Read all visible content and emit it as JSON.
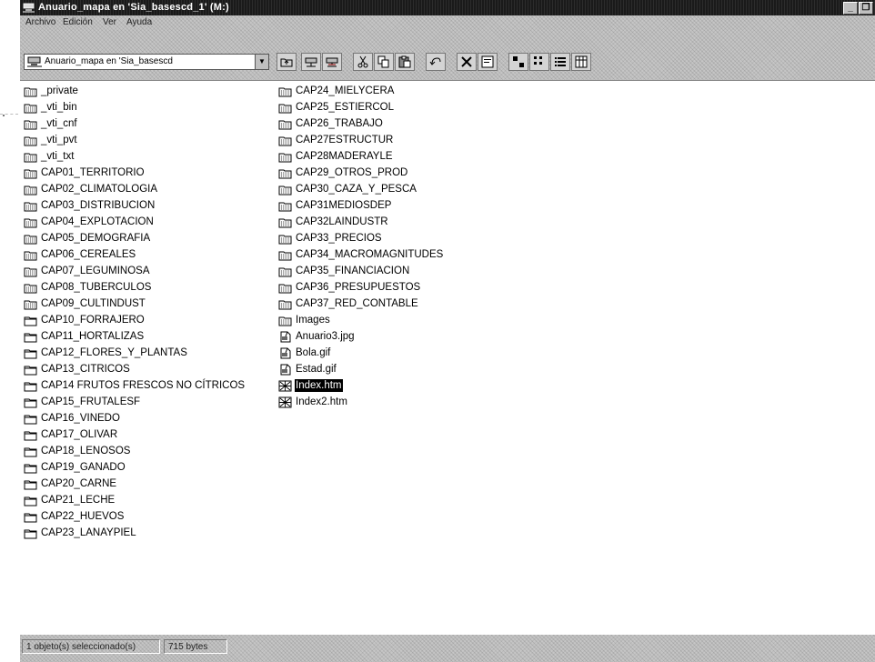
{
  "window": {
    "title": "Anuario_mapa en 'Sia_basescd_1' (M:)",
    "buttons": [
      "_",
      "❐"
    ]
  },
  "menu": [
    "Archivo",
    "Edición",
    "Ver",
    "Ayuda"
  ],
  "toolbar": {
    "address_text": "Anuario_mapa en 'Sia_basescd",
    "buttons": [
      "up-folder",
      "map-drive",
      "disconnect-drive",
      "cut",
      "copy",
      "paste",
      "undo",
      "delete",
      "properties",
      "large-icons",
      "small-icons",
      "list",
      "details"
    ]
  },
  "files": {
    "column1": [
      {
        "name": "_private",
        "type": "folder-special"
      },
      {
        "name": "_vti_bin",
        "type": "folder-special"
      },
      {
        "name": "_vti_cnf",
        "type": "folder-special"
      },
      {
        "name": "_vti_pvt",
        "type": "folder-special"
      },
      {
        "name": "_vti_txt",
        "type": "folder-special"
      },
      {
        "name": "CAP01_TERRITORIO",
        "type": "folder-special"
      },
      {
        "name": "CAP02_CLIMATOLOGIA",
        "type": "folder-special"
      },
      {
        "name": "CAP03_DISTRIBUCION",
        "type": "folder-special"
      },
      {
        "name": "CAP04_EXPLOTACION",
        "type": "folder-special"
      },
      {
        "name": "CAP05_DEMOGRAFIA",
        "type": "folder-special"
      },
      {
        "name": "CAP06_CEREALES",
        "type": "folder-special"
      },
      {
        "name": "CAP07_LEGUMINOSA",
        "type": "folder-special"
      },
      {
        "name": "CAP08_TUBERCULOS",
        "type": "folder-special"
      },
      {
        "name": "CAP09_CULTINDUST",
        "type": "folder-special"
      },
      {
        "name": "CAP10_FORRAJERO",
        "type": "folder"
      },
      {
        "name": "CAP11_HORTALIZAS",
        "type": "folder"
      },
      {
        "name": "CAP12_FLORES_Y_PLANTAS",
        "type": "folder"
      },
      {
        "name": "CAP13_CITRICOS",
        "type": "folder"
      },
      {
        "name": "CAP14 FRUTOS FRESCOS NO CÍTRICOS",
        "type": "folder"
      },
      {
        "name": "CAP15_FRUTALESF",
        "type": "folder"
      },
      {
        "name": "CAP16_VINEDO",
        "type": "folder"
      },
      {
        "name": "CAP17_OLIVAR",
        "type": "folder"
      },
      {
        "name": "CAP18_LENOSOS",
        "type": "folder"
      },
      {
        "name": "CAP19_GANADO",
        "type": "folder"
      },
      {
        "name": "CAP20_CARNE",
        "type": "folder"
      },
      {
        "name": "CAP21_LECHE",
        "type": "folder"
      },
      {
        "name": "CAP22_HUEVOS",
        "type": "folder"
      },
      {
        "name": "CAP23_LANAYPIEL",
        "type": "folder"
      }
    ],
    "column2": [
      {
        "name": "CAP24_MIELYCERA",
        "type": "folder-special"
      },
      {
        "name": "CAP25_ESTIERCOL",
        "type": "folder-special"
      },
      {
        "name": "CAP26_TRABAJO",
        "type": "folder-special"
      },
      {
        "name": "CAP27ESTRUCTUR",
        "type": "folder-special"
      },
      {
        "name": "CAP28MADERAYLE",
        "type": "folder-special"
      },
      {
        "name": "CAP29_OTROS_PROD",
        "type": "folder-special"
      },
      {
        "name": "CAP30_CAZA_Y_PESCA",
        "type": "folder-special"
      },
      {
        "name": "CAP31MEDIOSDEP",
        "type": "folder-special"
      },
      {
        "name": "CAP32LAINDUSTR",
        "type": "folder-special"
      },
      {
        "name": "CAP33_PRECIOS",
        "type": "folder-special"
      },
      {
        "name": "CAP34_MACROMAGNITUDES",
        "type": "folder-special"
      },
      {
        "name": "CAP35_FINANCIACION",
        "type": "folder-special"
      },
      {
        "name": "CAP36_PRESUPUESTOS",
        "type": "folder-special"
      },
      {
        "name": "CAP37_RED_CONTABLE",
        "type": "folder-special"
      },
      {
        "name": "Images",
        "type": "folder-special"
      },
      {
        "name": "Anuario3.jpg",
        "type": "image"
      },
      {
        "name": "Bola.gif",
        "type": "image"
      },
      {
        "name": "Estad.gif",
        "type": "image"
      },
      {
        "name": "Index.htm",
        "type": "html",
        "selected": true
      },
      {
        "name": "Index2.htm",
        "type": "html"
      }
    ]
  },
  "status": {
    "selection": "1 objeto(s) seleccionado(s)",
    "size": "715 bytes"
  }
}
